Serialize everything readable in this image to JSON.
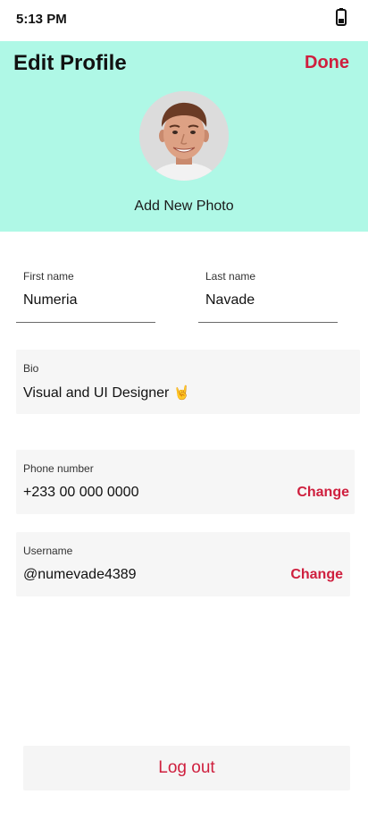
{
  "status_bar": {
    "time": "5:13 PM",
    "battery_icon": "battery-icon"
  },
  "header": {
    "title": "Edit Profile",
    "done_label": "Done",
    "add_photo_label": "Add New Photo",
    "accent_color": "#cf1f3e",
    "background_color": "#aff8e6"
  },
  "form": {
    "first_name": {
      "label": "First name",
      "value": "Numeria"
    },
    "last_name": {
      "label": "Last name",
      "value": "Navade"
    },
    "bio": {
      "label": "Bio",
      "value": "Visual and UI Designer",
      "emoji_icon": "rock-on-hand-icon"
    },
    "phone": {
      "label": "Phone number",
      "value": "+233 00 000 0000",
      "change_label": "Change"
    },
    "username": {
      "label": "Username",
      "value": "@numevade4389",
      "change_label": "Change"
    }
  },
  "footer": {
    "logout_label": "Log out"
  }
}
